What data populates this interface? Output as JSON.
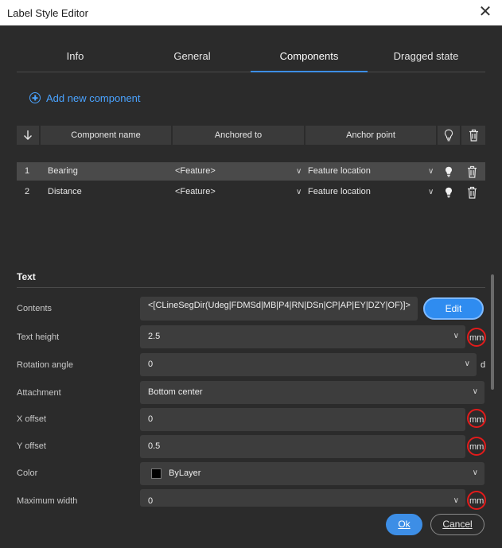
{
  "window": {
    "title": "Label Style Editor",
    "close_glyph": "✕"
  },
  "tabs": [
    {
      "label": "Info"
    },
    {
      "label": "General"
    },
    {
      "label": "Components",
      "active": true
    },
    {
      "label": "Dragged state"
    }
  ],
  "add_component_label": "Add new component",
  "table": {
    "sort_icon": "arrow-down-icon",
    "headers": [
      "Component name",
      "Anchored to",
      "Anchor point"
    ],
    "rows": [
      {
        "index": "1",
        "name": "Bearing",
        "anchored_to": "<Feature>",
        "anchor_point": "Feature location"
      },
      {
        "index": "2",
        "name": "Distance",
        "anchored_to": "<Feature>",
        "anchor_point": "Feature location"
      }
    ]
  },
  "text_section": {
    "title": "Text",
    "contents_label": "Contents",
    "contents_value": "<[CLineSegDir(Udeg|FDMSd|MB|P4|RN|DSn|CP|AP|EY|DZY|OF)]>",
    "edit_label": "Edit",
    "text_height_label": "Text height",
    "text_height_value": "2.5",
    "text_height_unit": "mm",
    "rotation_label": "Rotation angle",
    "rotation_value": "0",
    "rotation_unit": "d",
    "attachment_label": "Attachment",
    "attachment_value": "Bottom center",
    "x_offset_label": "X offset",
    "x_offset_value": "0",
    "x_offset_unit": "mm",
    "y_offset_label": "Y offset",
    "y_offset_value": "0.5",
    "y_offset_unit": "mm",
    "color_label": "Color",
    "color_value": "ByLayer",
    "max_width_label": "Maximum width",
    "max_width_value": "0",
    "max_width_unit": "mm"
  },
  "footer": {
    "ok_label": "Ok",
    "cancel_label": "Cancel"
  },
  "colors": {
    "accent": "#3d8ee6",
    "highlight_circle": "#e21b1b",
    "background": "#2b2b2b"
  }
}
